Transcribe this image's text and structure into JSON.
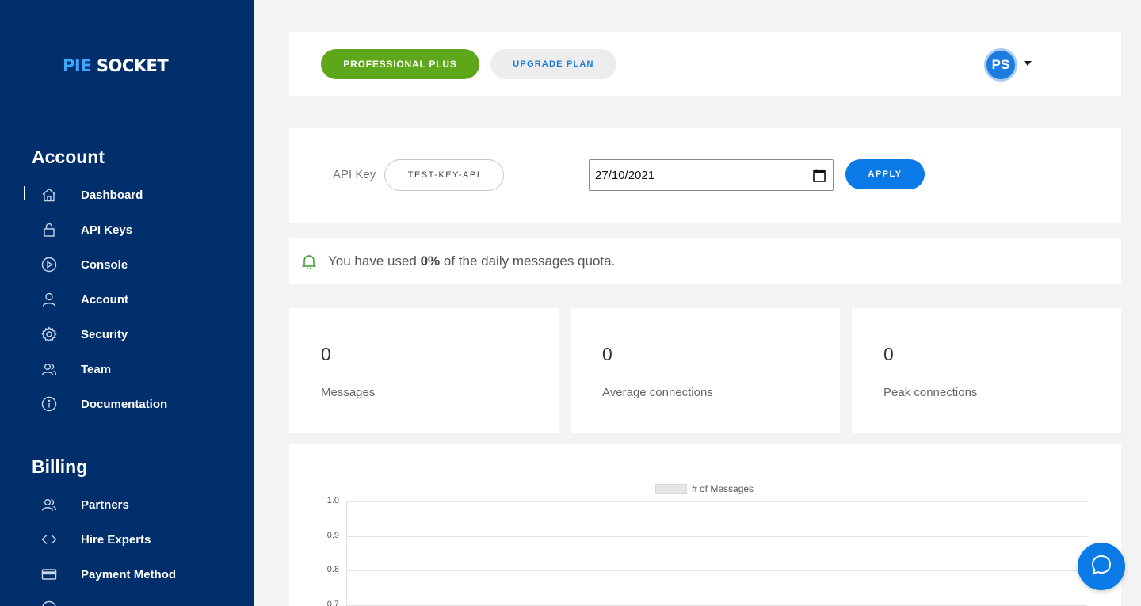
{
  "brand": {
    "part1": "PIE",
    "part2": "SOCKET"
  },
  "sidebar": {
    "account_title": "Account",
    "billing_title": "Billing",
    "account_items": [
      {
        "label": "Dashboard",
        "icon": "home-icon"
      },
      {
        "label": "API Keys",
        "icon": "lock-icon"
      },
      {
        "label": "Console",
        "icon": "play-circle-icon"
      },
      {
        "label": "Account",
        "icon": "user-icon"
      },
      {
        "label": "Security",
        "icon": "gear-icon"
      },
      {
        "label": "Team",
        "icon": "users-icon"
      },
      {
        "label": "Documentation",
        "icon": "info-icon"
      }
    ],
    "billing_items": [
      {
        "label": "Partners",
        "icon": "users-icon"
      },
      {
        "label": "Hire Experts",
        "icon": "code-icon"
      },
      {
        "label": "Payment Method",
        "icon": "credit-card-icon"
      }
    ]
  },
  "header": {
    "plan_label": "PROFESSIONAL PLUS",
    "upgrade_label": "UPGRADE PLAN",
    "avatar_initials": "PS"
  },
  "filter": {
    "api_key_label": "API Key",
    "api_key_value": "TEST-KEY-API",
    "date_value": "27/10/2021",
    "apply_label": "APPLY"
  },
  "quota": {
    "prefix": "You have used ",
    "percent": "0%",
    "suffix": " of the daily messages quota."
  },
  "stats": [
    {
      "value": "0",
      "label": "Messages"
    },
    {
      "value": "0",
      "label": "Average connections"
    },
    {
      "value": "0",
      "label": "Peak connections"
    }
  ],
  "chart_data": {
    "type": "line",
    "title": "",
    "xlabel": "",
    "ylabel": "",
    "series": [
      {
        "name": "# of Messages",
        "values": []
      }
    ],
    "yticks": [
      "1.0",
      "0.9",
      "0.8",
      "0.7"
    ],
    "ylim": [
      0,
      1.0
    ],
    "grid": true,
    "legend": "top-center"
  },
  "colors": {
    "sidebar_bg": "#002f6c",
    "plan_green": "#5fa71a",
    "primary_blue": "#0a7be6",
    "page_bg": "#f3f3f3"
  }
}
